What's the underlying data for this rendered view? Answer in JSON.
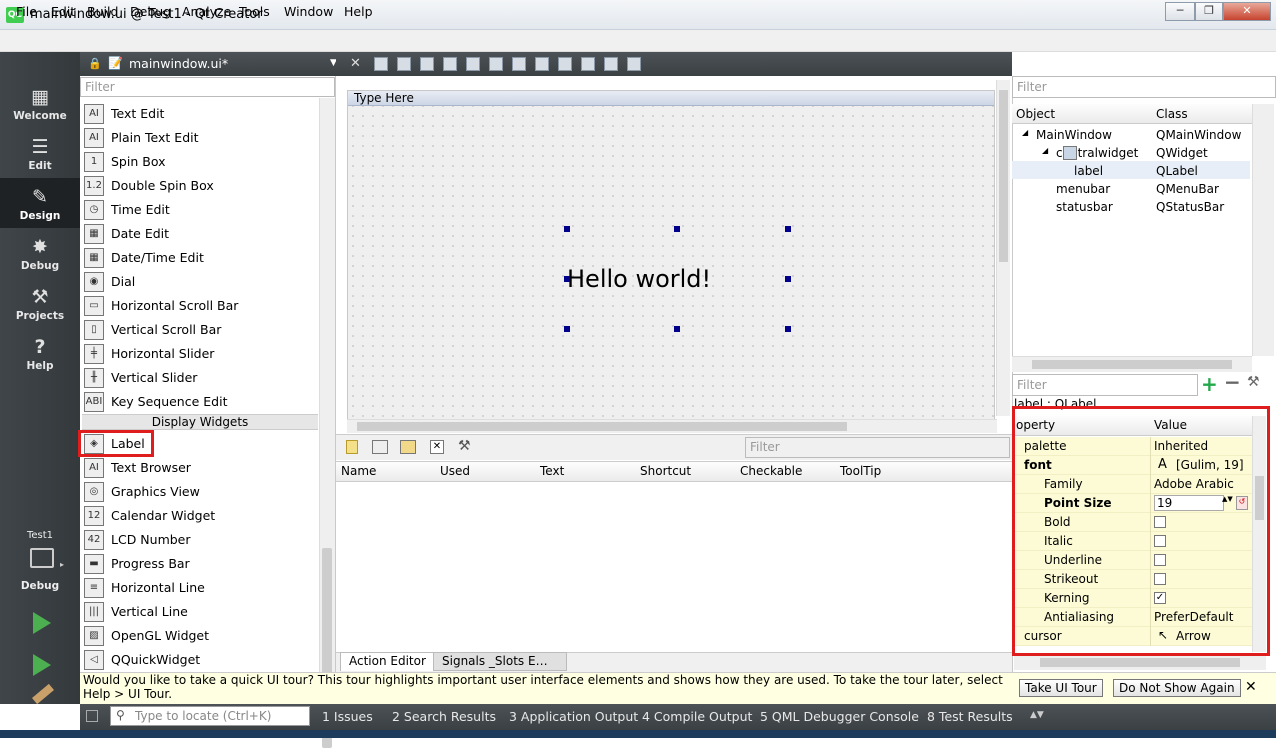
{
  "window": {
    "title": "mainwindow.ui @ Test1 - Qt Creator",
    "logo": "QC"
  },
  "menus": [
    "File",
    "Edit",
    "Build",
    "Debug",
    "Analyze",
    "Tools",
    "Window",
    "Help"
  ],
  "modes": [
    {
      "label": "Welcome",
      "icon": "grid-icon"
    },
    {
      "label": "Edit",
      "icon": "document-icon"
    },
    {
      "label": "Design",
      "icon": "pencil-icon"
    },
    {
      "label": "Debug",
      "icon": "bug-icon"
    },
    {
      "label": "Projects",
      "icon": "wrench-icon"
    },
    {
      "label": "Help",
      "icon": "help-icon"
    }
  ],
  "target": {
    "project": "Test1",
    "config": "Debug"
  },
  "editor": {
    "file": "mainwindow.ui*"
  },
  "widgetbox": {
    "filter_placeholder": "Filter",
    "items": [
      {
        "label": "Text Edit",
        "glyph": "AI"
      },
      {
        "label": "Plain Text Edit",
        "glyph": "AI"
      },
      {
        "label": "Spin Box",
        "glyph": "1"
      },
      {
        "label": "Double Spin Box",
        "glyph": "1.2"
      },
      {
        "label": "Time Edit",
        "glyph": "◷"
      },
      {
        "label": "Date Edit",
        "glyph": "▦"
      },
      {
        "label": "Date/Time Edit",
        "glyph": "▦"
      },
      {
        "label": "Dial",
        "glyph": "◉"
      },
      {
        "label": "Horizontal Scroll Bar",
        "glyph": "▭"
      },
      {
        "label": "Vertical Scroll Bar",
        "glyph": "▯"
      },
      {
        "label": "Horizontal Slider",
        "glyph": "╪"
      },
      {
        "label": "Vertical Slider",
        "glyph": "╫"
      },
      {
        "label": "Key Sequence Edit",
        "glyph": "ABI"
      }
    ],
    "category": "Display Widgets",
    "display_items": [
      {
        "label": "Label",
        "glyph": "◈"
      },
      {
        "label": "Text Browser",
        "glyph": "AI"
      },
      {
        "label": "Graphics View",
        "glyph": "◎"
      },
      {
        "label": "Calendar Widget",
        "glyph": "12"
      },
      {
        "label": "LCD Number",
        "glyph": "42"
      },
      {
        "label": "Progress Bar",
        "glyph": "▬"
      },
      {
        "label": "Horizontal Line",
        "glyph": "≡"
      },
      {
        "label": "Vertical Line",
        "glyph": "|||"
      },
      {
        "label": "OpenGL Widget",
        "glyph": "▨"
      },
      {
        "label": "QQuickWidget",
        "glyph": "◁"
      }
    ]
  },
  "form": {
    "menu_placeholder": "Type Here",
    "label_text": "Hello world!"
  },
  "action_editor": {
    "filter_placeholder": "Filter",
    "columns": [
      "Name",
      "Used",
      "Text",
      "Shortcut",
      "Checkable",
      "ToolTip"
    ],
    "tabs": [
      "Action Editor",
      "Signals _Slots E…"
    ]
  },
  "object_inspector": {
    "filter_placeholder": "Filter",
    "columns": [
      "Object",
      "Class"
    ],
    "rows": [
      {
        "object": "MainWindow",
        "class": "QMainWindow",
        "level": 0,
        "expander": "◢"
      },
      {
        "object": "centralwidget",
        "class": "QWidget",
        "level": 1,
        "expander": "◢"
      },
      {
        "object": "label",
        "class": "QLabel",
        "level": 2,
        "expander": ""
      },
      {
        "object": "menubar",
        "class": "QMenuBar",
        "level": 1,
        "expander": ""
      },
      {
        "object": "statusbar",
        "class": "QStatusBar",
        "level": 1,
        "expander": ""
      }
    ]
  },
  "property_editor": {
    "filter_placeholder": "Filter",
    "object_label": "label : QLabel",
    "columns": [
      "operty",
      "Value"
    ],
    "rows": [
      {
        "name": "palette",
        "value": "Inherited",
        "indent": 1,
        "bold": false,
        "type": "text"
      },
      {
        "name": "font",
        "value": "[Gulim, 19]",
        "indent": 1,
        "bold": true,
        "type": "font"
      },
      {
        "name": "Family",
        "value": "Adobe Arabic",
        "indent": 2,
        "bold": false,
        "type": "text"
      },
      {
        "name": "Point Size",
        "value": "19",
        "indent": 2,
        "bold": true,
        "type": "spin"
      },
      {
        "name": "Bold",
        "value": "",
        "indent": 2,
        "bold": false,
        "type": "check",
        "checked": false
      },
      {
        "name": "Italic",
        "value": "",
        "indent": 2,
        "bold": false,
        "type": "check",
        "checked": false
      },
      {
        "name": "Underline",
        "value": "",
        "indent": 2,
        "bold": false,
        "type": "check",
        "checked": false
      },
      {
        "name": "Strikeout",
        "value": "",
        "indent": 2,
        "bold": false,
        "type": "check",
        "checked": false
      },
      {
        "name": "Kerning",
        "value": "",
        "indent": 2,
        "bold": false,
        "type": "check",
        "checked": true
      },
      {
        "name": "Antialiasing",
        "value": "PreferDefault",
        "indent": 2,
        "bold": false,
        "type": "text"
      },
      {
        "name": "cursor",
        "value": "Arrow",
        "indent": 1,
        "bold": false,
        "type": "cursor"
      }
    ]
  },
  "tour": {
    "text": "Would you like to take a quick UI tour? This tour highlights important user interface elements and shows how they are used. To take the tour later, select Help > UI Tour.",
    "take_label": "Take UI Tour",
    "dismiss_label": "Do Not Show Again"
  },
  "statusbar": {
    "locate_placeholder": "Type to locate (Ctrl+K)",
    "panes": [
      "1  Issues",
      "2  Search Results",
      "3  Application Output",
      "4  Compile Output",
      "5  QML Debugger Console",
      "8  Test Results"
    ]
  },
  "colors": {
    "highlight_red": "#e01d1d",
    "property_yellow": "#fdfbd6",
    "sidebar_dark": "#3f4549"
  }
}
